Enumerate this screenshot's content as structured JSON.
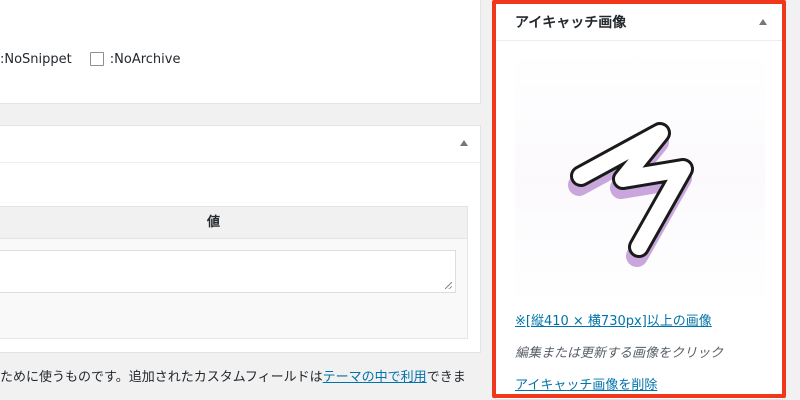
{
  "robots": {
    "nosnippet_label": ":NoSnippet",
    "noarchive_label": ":NoArchive"
  },
  "custom_fields": {
    "value_header": "値",
    "note_prefix": "ために使うものです。追加されたカスタムフィールドは",
    "note_link": "テーマの中で利用",
    "note_suffix": "できま"
  },
  "eyecatch": {
    "title": "アイキャッチ画像",
    "size_link": "※[縦410 × 横730px]以上の画像",
    "hint": "編集または更新する画像をクリック",
    "remove_link": "アイキャッチ画像を削除",
    "highlight_color": "#f0371b",
    "link_color": "#0073aa"
  }
}
